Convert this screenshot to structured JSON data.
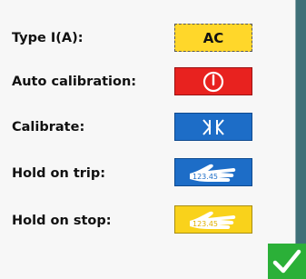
{
  "rows": [
    {
      "label": "Type I(A):",
      "button_text": "AC"
    },
    {
      "label": "Auto calibration:",
      "button_icon": "power-icon"
    },
    {
      "label": "Calibrate:",
      "button_icon": "calibrate-icon"
    },
    {
      "label": "Hold on trip:",
      "button_icon": "hand-value-icon",
      "icon_text": "123.45"
    },
    {
      "label": "Hold on stop:",
      "button_icon": "hand-value-icon",
      "icon_text": "123.45"
    }
  ],
  "ok_icon": "checkmark-icon",
  "colors": {
    "ac_button": "#ffd72a",
    "auto_calibration_button": "#e8221f",
    "calibrate_button": "#1d6dc7",
    "hold_on_trip_button": "#1d6dc7",
    "hold_on_stop_button": "#f9d21b",
    "ok_button": "#2bb038",
    "frame_background": "#3f7078"
  }
}
